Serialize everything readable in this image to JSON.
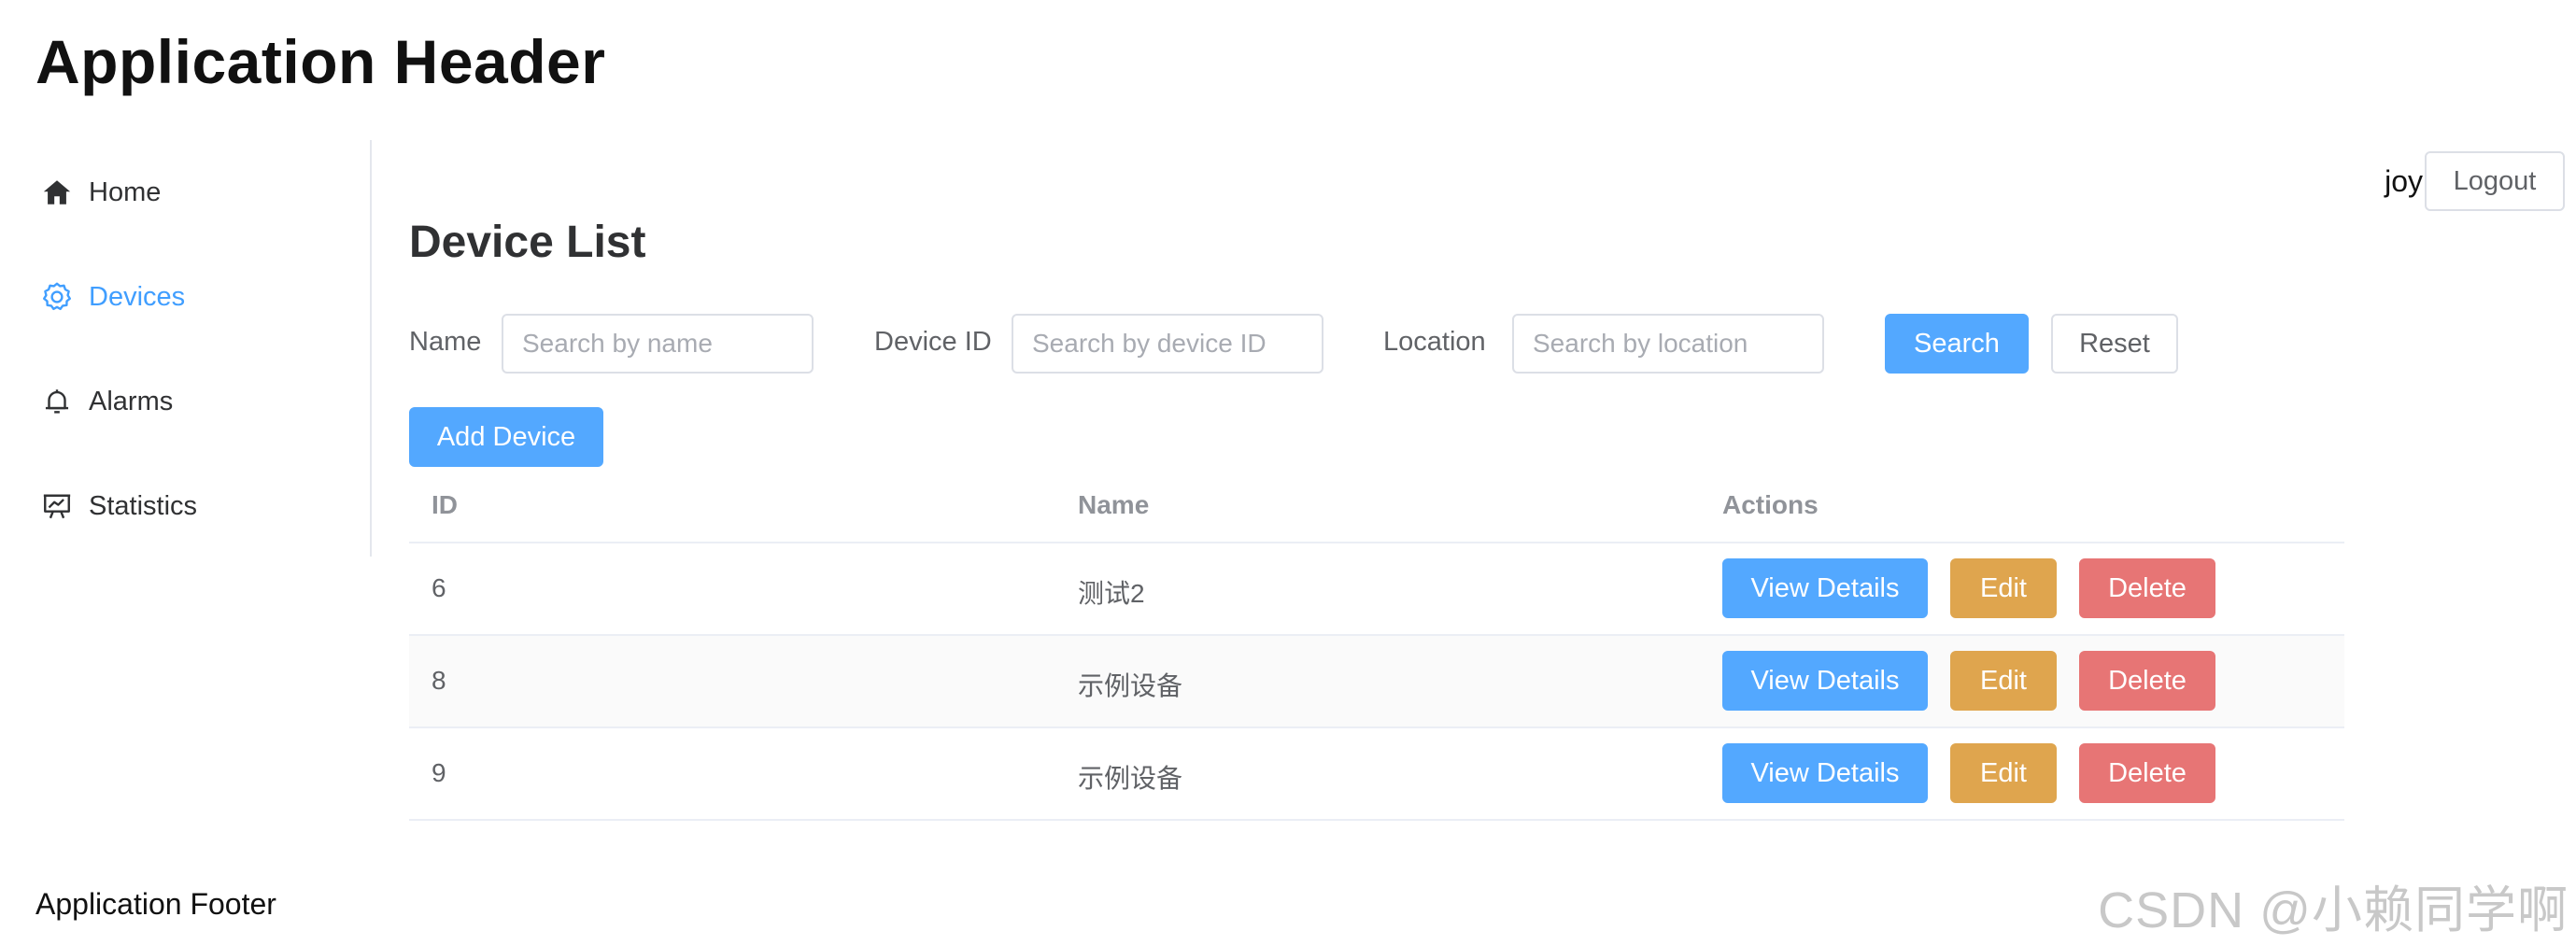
{
  "header": {
    "title": "Application Header"
  },
  "sidebar": {
    "items": [
      {
        "label": "Home",
        "icon": "home-icon",
        "active": false
      },
      {
        "label": "Devices",
        "icon": "gear-icon",
        "active": true
      },
      {
        "label": "Alarms",
        "icon": "bell-icon",
        "active": false
      },
      {
        "label": "Statistics",
        "icon": "presentation-chart-icon",
        "active": false
      }
    ]
  },
  "user": {
    "name": "joy",
    "logout_label": "Logout"
  },
  "main": {
    "title": "Device List",
    "filters": {
      "name": {
        "label": "Name",
        "placeholder": "Search by name",
        "value": ""
      },
      "device_id": {
        "label": "Device ID",
        "placeholder": "Search by device ID",
        "value": ""
      },
      "location": {
        "label": "Location",
        "placeholder": "Search by location",
        "value": ""
      },
      "search_label": "Search",
      "reset_label": "Reset"
    },
    "add_label": "Add Device",
    "table": {
      "columns": [
        "ID",
        "Name",
        "Actions"
      ],
      "rows": [
        {
          "id": "6",
          "name": "测试2"
        },
        {
          "id": "8",
          "name": "示例设备"
        },
        {
          "id": "9",
          "name": "示例设备"
        }
      ],
      "action_labels": {
        "view": "View Details",
        "edit": "Edit",
        "delete": "Delete"
      }
    }
  },
  "footer": {
    "text": "Application Footer"
  },
  "watermark": "CSDN @小赖同学啊",
  "colors": {
    "accent": "#409eff",
    "primary_button": "#53a8ff",
    "warning_button": "#dfa54e",
    "danger_button": "#e77575"
  }
}
